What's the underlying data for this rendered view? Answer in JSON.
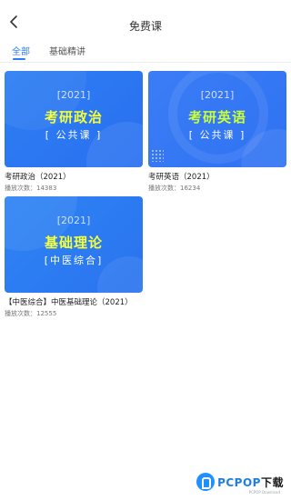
{
  "header": {
    "title": "免费课",
    "back_icon": "chevron-left-icon"
  },
  "tabs": [
    {
      "label": "全部",
      "active": true
    },
    {
      "label": "基础精讲",
      "active": false
    }
  ],
  "courses": [
    {
      "cover": {
        "year": "[2021]",
        "title": "考研政治",
        "subtitle": "[ 公共课 ]"
      },
      "name": "考研政治（2021）",
      "plays": "播放次数：14383"
    },
    {
      "cover": {
        "year": "[2021]",
        "title": "考研英语",
        "subtitle": "[ 公共课 ]"
      },
      "name": "考研英语（2021）",
      "plays": "播放次数：16234"
    },
    {
      "cover": {
        "year": "[2021]",
        "title": "基础理论",
        "subtitle": "[中医综合]"
      },
      "name": "【中医综合】中医基础理论（2021）",
      "plays": "播放次数：12555"
    }
  ],
  "watermark": {
    "brand": "PCPOP",
    "suffix": "下载",
    "small": "PCPOP Download"
  },
  "colors": {
    "accent": "#2b7cf6",
    "cover_blue": "#2f7ff5",
    "highlight": "#f5ff3a"
  }
}
